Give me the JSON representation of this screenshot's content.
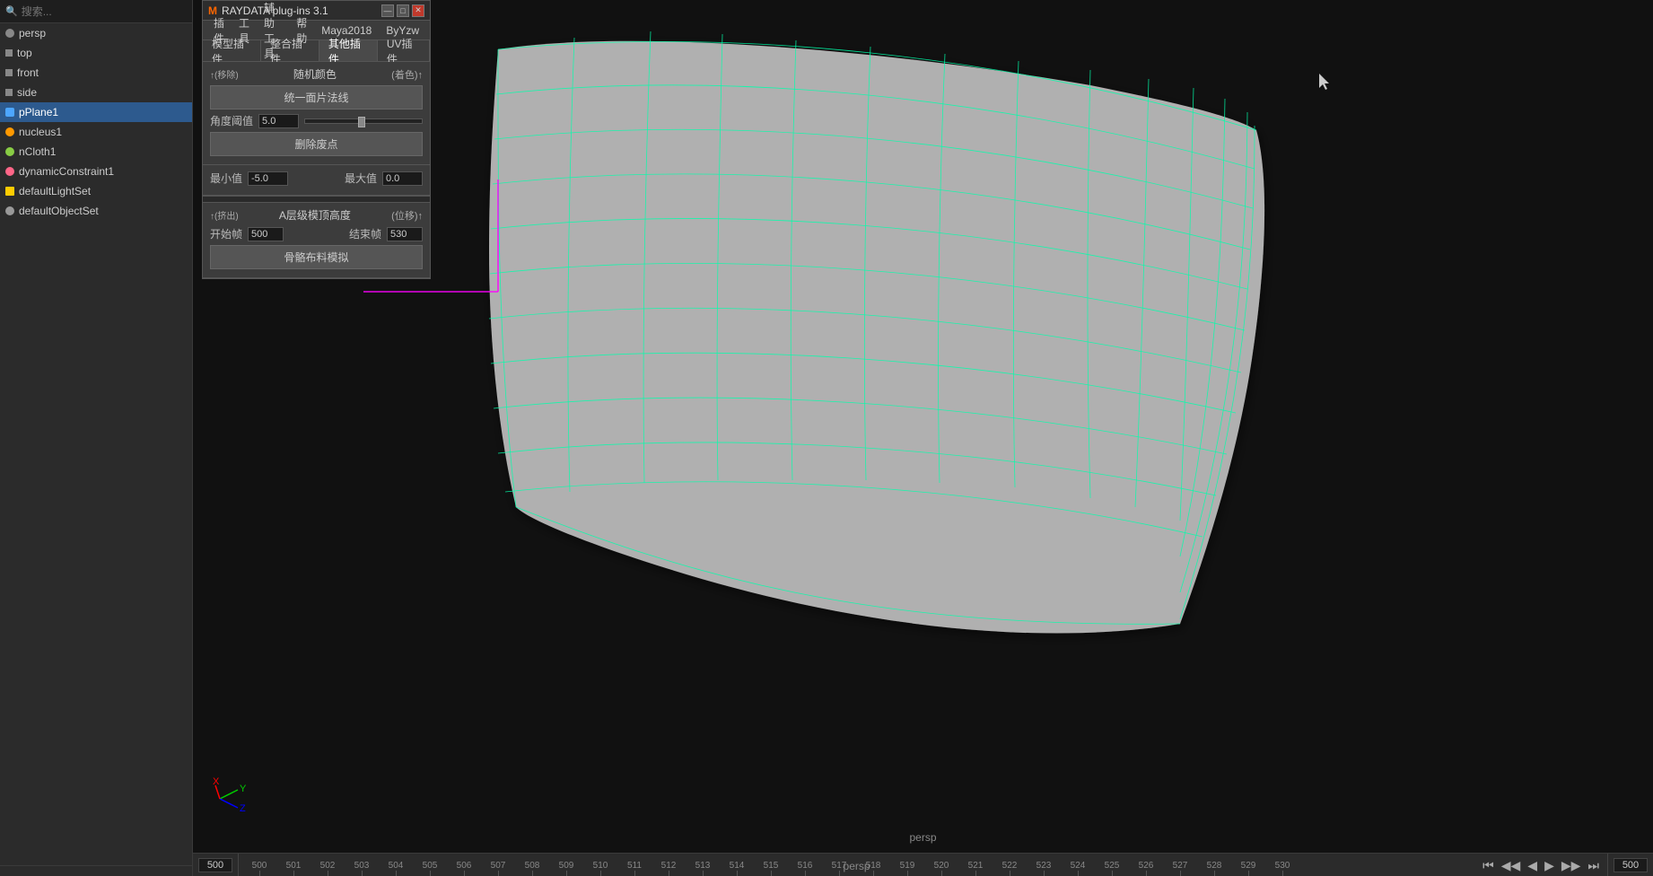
{
  "sidebar": {
    "search_placeholder": "搜索...",
    "items": [
      {
        "name": "persp",
        "icon": "cam",
        "selected": false
      },
      {
        "name": "top",
        "icon": "cam-small",
        "selected": false
      },
      {
        "name": "front",
        "icon": "cam-small",
        "selected": false
      },
      {
        "name": "side",
        "icon": "cam-small",
        "selected": false
      },
      {
        "name": "pPlane1",
        "icon": "mesh",
        "selected": true
      },
      {
        "name": "nucleus1",
        "icon": "nucleus",
        "selected": false
      },
      {
        "name": "nCloth1",
        "icon": "cloth",
        "selected": false
      },
      {
        "name": "dynamicConstraint1",
        "icon": "constraint",
        "selected": false
      },
      {
        "name": "defaultLightSet",
        "icon": "lightset",
        "selected": false
      },
      {
        "name": "defaultObjectSet",
        "icon": "objset",
        "selected": false
      }
    ]
  },
  "plugin_panel": {
    "title_logo": "M",
    "title_text": "RAYDATA plug-ins 3.1",
    "btn_minimize": "—",
    "btn_restore": "□",
    "btn_close": "✕",
    "menubar": [
      "插件",
      "工具",
      "辅助工具",
      "帮助",
      "Maya2018",
      "ByYzw"
    ],
    "tabs": [
      {
        "label": "模型插件",
        "active": false
      },
      {
        "label": "整合插件",
        "active": false
      },
      {
        "label": "其他插件",
        "active": true
      },
      {
        "label": "UV插件",
        "active": false
      }
    ],
    "section1": {
      "header_left": "↑(移除)",
      "header_center": "随机颜色",
      "header_right": "(着色)↑",
      "btn_normals": "统一面片法线",
      "slider_label": "角度阈值",
      "slider_value": "5.0",
      "btn_delete_verts": "删除废点"
    },
    "section2": {
      "min_label": "最小值",
      "min_value": "-5.0",
      "max_label": "最大值",
      "max_value": "0.0"
    },
    "section3": {
      "header_left": "↑(挤出)",
      "header_center": "A层级模顶高度",
      "header_right": "(位移)↑",
      "start_label": "开始帧",
      "start_value": "500",
      "end_label": "结束帧",
      "end_value": "530",
      "btn_simulate": "骨骼布料模拟"
    }
  },
  "viewport": {
    "label": "persp"
  },
  "timeline": {
    "ticks": [
      500,
      501,
      502,
      503,
      504,
      505,
      506,
      507,
      508,
      509,
      510,
      511,
      512,
      513,
      514,
      515,
      516,
      517,
      518,
      519,
      520,
      521,
      522,
      523,
      524,
      525,
      526,
      527,
      528,
      529,
      530
    ],
    "current_frame": "500",
    "end_frame": "500",
    "btn_skip_start": "⏮",
    "btn_prev_key": "◀◀",
    "btn_prev": "◀",
    "btn_next": "▶",
    "btn_next_key": "▶▶",
    "btn_skip_end": "⏭"
  }
}
